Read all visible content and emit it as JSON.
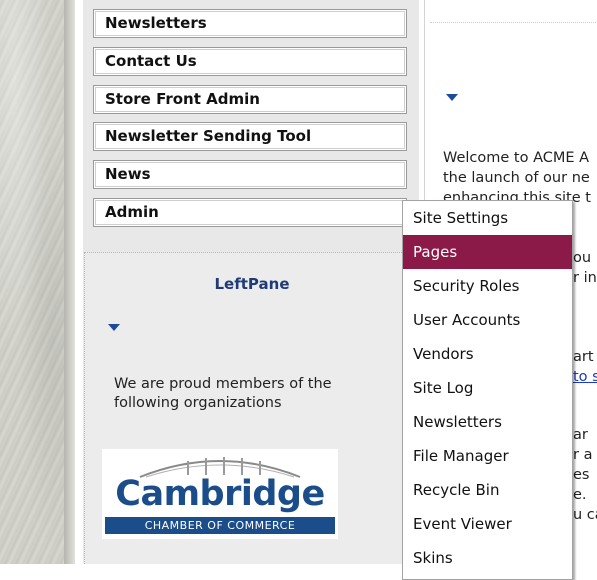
{
  "nav": {
    "items": [
      {
        "label": "Newsletters"
      },
      {
        "label": "Contact Us"
      },
      {
        "label": "Store Front Admin"
      },
      {
        "label": "Newsletter Sending Tool"
      },
      {
        "label": "News"
      },
      {
        "label": "Admin"
      }
    ]
  },
  "left_pane": {
    "title": "LeftPane",
    "text": "We are proud members of the following organizations",
    "logo": {
      "name": "Cambridge",
      "subtitle": "CHAMBER OF COMMERCE"
    }
  },
  "main": {
    "line1": "Welcome to ACME A",
    "line2": "the launch of our ne",
    "line3": "enhancing this site t",
    "frag1": "ou",
    "frag2": "r in",
    "frag3": "art",
    "frag4_link": "to s",
    "frag5": "ar",
    "frag6": "r a",
    "frag7": "es",
    "frag8": "e.",
    "frag9": "u ca"
  },
  "admin_dropdown": {
    "active_index": 1,
    "items": [
      {
        "label": "Site Settings"
      },
      {
        "label": "Pages"
      },
      {
        "label": "Security Roles"
      },
      {
        "label": "User Accounts"
      },
      {
        "label": "Vendors"
      },
      {
        "label": "Site Log"
      },
      {
        "label": "Newsletters"
      },
      {
        "label": "File Manager"
      },
      {
        "label": "Recycle Bin"
      },
      {
        "label": "Event Viewer"
      },
      {
        "label": "Skins"
      }
    ]
  },
  "colors": {
    "menu_highlight": "#8c1a48",
    "pane_title": "#1f3b75",
    "link": "#1a39c7",
    "logo_blue": "#1b4d8a"
  },
  "icons": [
    "collapse-triangle-icon"
  ]
}
